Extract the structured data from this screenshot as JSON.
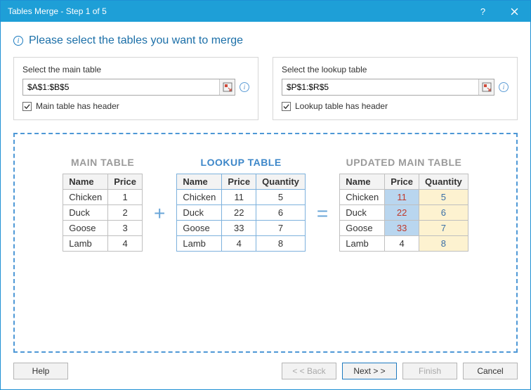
{
  "titlebar": {
    "title": "Tables Merge - Step 1 of 5"
  },
  "heading": "Please select the tables you want to merge",
  "mainSelector": {
    "label": "Select the main table",
    "value": "$A$1:$B$5",
    "checkboxLabel": "Main table has header"
  },
  "lookupSelector": {
    "label": "Select the lookup table",
    "value": "$P$1:$R$5",
    "checkboxLabel": "Lookup table has header"
  },
  "preview": {
    "mainTitle": "MAIN TABLE",
    "lookupTitle": "LOOKUP TABLE",
    "updatedTitle": "UPDATED MAIN TABLE",
    "headers": {
      "name": "Name",
      "price": "Price",
      "qty": "Quantity"
    },
    "plus": "+",
    "equals": "=",
    "mainRows": [
      {
        "name": "Chicken",
        "price": "1"
      },
      {
        "name": "Duck",
        "price": "2"
      },
      {
        "name": "Goose",
        "price": "3"
      },
      {
        "name": "Lamb",
        "price": "4"
      }
    ],
    "lookupRows": [
      {
        "name": "Chicken",
        "price": "11",
        "qty": "5"
      },
      {
        "name": "Duck",
        "price": "22",
        "qty": "6"
      },
      {
        "name": "Goose",
        "price": "33",
        "qty": "7"
      },
      {
        "name": "Lamb",
        "price": "4",
        "qty": "8"
      }
    ],
    "updatedRows": [
      {
        "name": "Chicken",
        "price": "11",
        "qty": "5",
        "priceHl": true
      },
      {
        "name": "Duck",
        "price": "22",
        "qty": "6",
        "priceHl": true
      },
      {
        "name": "Goose",
        "price": "33",
        "qty": "7",
        "priceHl": true
      },
      {
        "name": "Lamb",
        "price": "4",
        "qty": "8",
        "priceHl": false
      }
    ]
  },
  "footer": {
    "help": "Help",
    "back": "< < Back",
    "next": "Next > >",
    "finish": "Finish",
    "cancel": "Cancel"
  }
}
